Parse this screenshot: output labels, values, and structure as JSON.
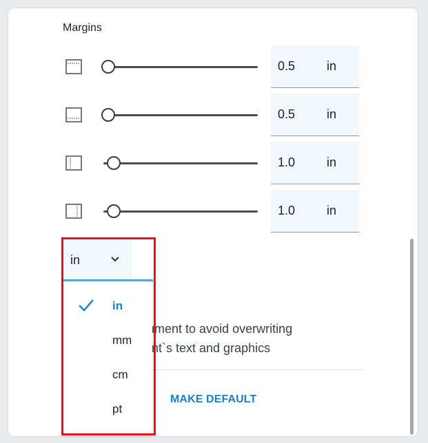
{
  "margins": {
    "title": "Margins",
    "rows": [
      {
        "name": "top",
        "icon": "margin-top-icon",
        "value": "0.5",
        "unit": "in",
        "slider_fraction": 0.0
      },
      {
        "name": "bottom",
        "icon": "margin-bottom-icon",
        "value": "0.5",
        "unit": "in",
        "slider_fraction": 0.0
      },
      {
        "name": "left",
        "icon": "margin-left-icon",
        "value": "1.0",
        "unit": "in",
        "slider_fraction": 0.06
      },
      {
        "name": "right",
        "icon": "margin-right-icon",
        "value": "1.0",
        "unit": "in",
        "slider_fraction": 0.06
      }
    ]
  },
  "unit_select": {
    "value": "in",
    "icon": "chevron-down-icon",
    "options": [
      {
        "label": "in",
        "selected": true
      },
      {
        "label": "mm",
        "selected": false
      },
      {
        "label": "cm",
        "selected": false
      },
      {
        "label": "pt",
        "selected": false
      }
    ]
  },
  "description": {
    "line1": "ocument to avoid overwriting",
    "line2": "ment`s text and graphics"
  },
  "actions": {
    "make_default_label": "MAKE DEFAULT"
  },
  "colors": {
    "accent": "#1a7fd1",
    "field_bg": "#f2f7fb",
    "underline": "#5aaad6",
    "highlight": "#e5101a"
  }
}
